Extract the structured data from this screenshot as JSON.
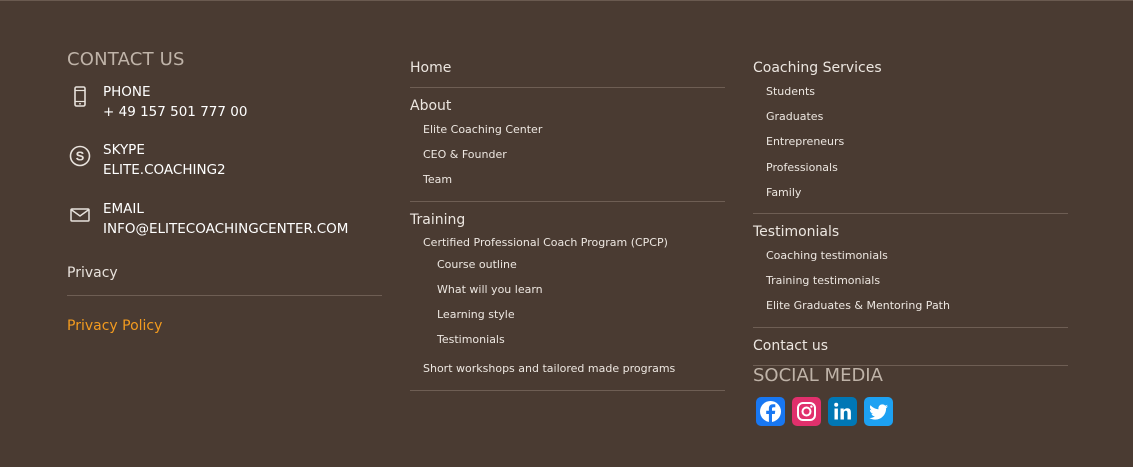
{
  "contact": {
    "title": "CONTACT US",
    "phone": {
      "label": "PHONE",
      "value": "+ 49 157 501 777 00"
    },
    "skype": {
      "label": "SKYPE",
      "value": "ELITE.COACHING2"
    },
    "email": {
      "label": "EMAIL",
      "value": "INFO@ELITECOACHINGCENTER.COM"
    },
    "privacy_heading": "Privacy",
    "privacy_link": "Privacy Policy"
  },
  "menu_middle": {
    "home": "Home",
    "about": {
      "label": "About",
      "items": [
        "Elite Coaching Center",
        "CEO & Founder",
        "Team"
      ]
    },
    "training": {
      "label": "Training",
      "cpcp": "Certified Professional Coach Program (CPCP)",
      "cpcp_items": [
        "Course outline",
        "What will you learn",
        "Learning style",
        "Testimonials"
      ],
      "short": "Short workshops and tailored made programs"
    }
  },
  "menu_right": {
    "coaching": {
      "label": "Coaching Services",
      "items": [
        "Students",
        "Graduates",
        "Entrepreneurs",
        "Professionals",
        "Family"
      ]
    },
    "testimonials": {
      "label": "Testimonials",
      "items": [
        "Coaching testimonials",
        "Training testimonials",
        "Elite Graduates & Mentoring Path"
      ]
    },
    "contact": "Contact us",
    "social_title": "SOCIAL MEDIA",
    "social": [
      {
        "name": "Facebook",
        "icon": "facebook-icon",
        "color": "#1877f2"
      },
      {
        "name": "Instagram",
        "icon": "instagram-icon",
        "color": "#e1306c"
      },
      {
        "name": "LinkedIn",
        "icon": "linkedin-icon",
        "color": "#0077b5"
      },
      {
        "name": "Twitter",
        "icon": "twitter-icon",
        "color": "#1da1f2"
      }
    ]
  },
  "colors": {
    "background": "#4a3b32",
    "accent": "#f39b1f",
    "muted_title": "#bfb3a8"
  }
}
